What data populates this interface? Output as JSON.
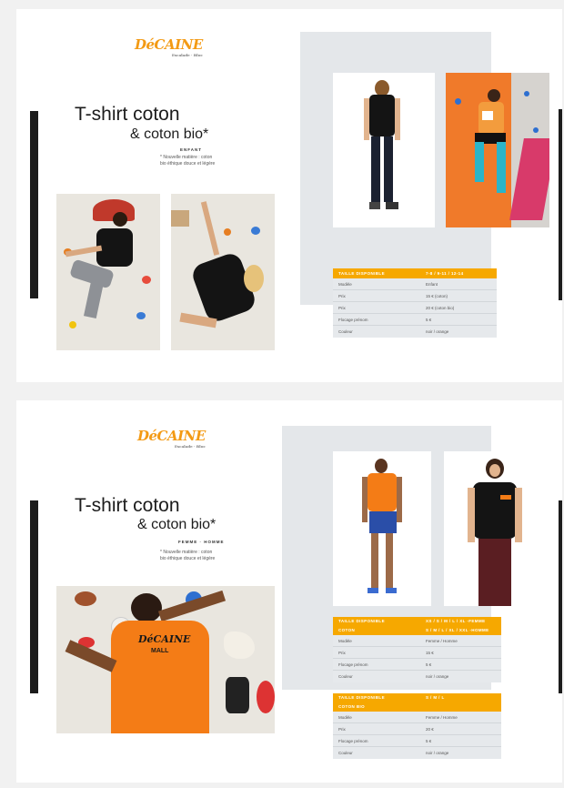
{
  "brand": {
    "logo": "DéCAINE",
    "logo_sub": "Escalade · Bloc"
  },
  "page1": {
    "title": "T-shirt coton",
    "subtitle": "& coton bio*",
    "category": "ENFANT",
    "note_line1": "* Nouvelle matière : coton",
    "note_line2": "bio éthique douce et légère",
    "table": {
      "header": [
        "TAILLE DISPONIBLE",
        "7-8 / 9-11 / 12-14"
      ],
      "rows": [
        [
          "Modèle",
          "Enfant"
        ],
        [
          "Prix",
          "15 € (coton)"
        ],
        [
          "Prix",
          "20 € (coton bio)"
        ],
        [
          "Flocage prénom",
          "5 €"
        ],
        [
          "Couleur",
          "noir / orange"
        ]
      ]
    }
  },
  "page2": {
    "title": "T-shirt coton",
    "subtitle": "& coton bio*",
    "category": "FEMME · HOMME",
    "note_line1": "* Nouvelle matière : coton",
    "note_line2": "bio éthique douce et légère",
    "table1": {
      "header1": [
        "TAILLE DISPONIBLE",
        "XS / S / M / L / XL -FEMME"
      ],
      "header2": [
        "COTON",
        "S / M / L / XL / XXL -HOMME"
      ],
      "rows": [
        [
          "Modèle",
          "Femme / Homme"
        ],
        [
          "Prix",
          "15 €"
        ],
        [
          "Flocage prénom",
          "5 €"
        ],
        [
          "Couleur",
          "noir / orange"
        ]
      ]
    },
    "table2": {
      "header1": [
        "TAILLE DISPONIBLE",
        "S / M / L"
      ],
      "header2": [
        "COTON BIO",
        ""
      ],
      "rows": [
        [
          "Modèle",
          "Femme / Homme"
        ],
        [
          "Prix",
          "20 €"
        ],
        [
          "Flocage prénom",
          "5 €"
        ],
        [
          "Couleur",
          "noir / orange"
        ]
      ]
    },
    "shirt_print": "MALL"
  },
  "colors": {
    "accent": "#f6a800",
    "dark": "#1c1c1c",
    "panel": "#e4e7ea"
  }
}
